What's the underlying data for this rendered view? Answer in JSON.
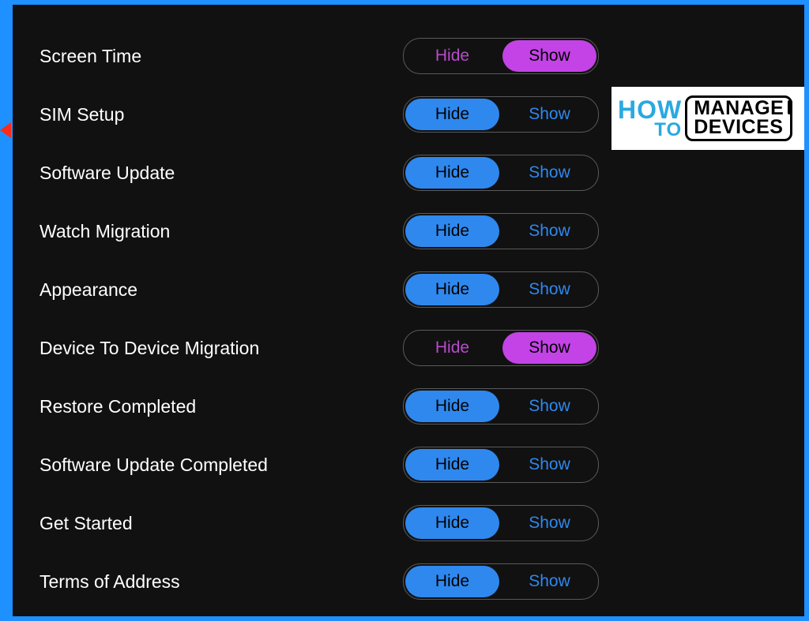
{
  "toggle_labels": {
    "hide": "Hide",
    "show": "Show"
  },
  "logo": {
    "how": "HOW",
    "to": "TO",
    "manage": "MANAGE",
    "devices": "DEVICES"
  },
  "rows": [
    {
      "label": "Screen Time",
      "state": "show"
    },
    {
      "label": "SIM Setup",
      "state": "hide"
    },
    {
      "label": "Software Update",
      "state": "hide"
    },
    {
      "label": "Watch Migration",
      "state": "hide"
    },
    {
      "label": "Appearance",
      "state": "hide"
    },
    {
      "label": "Device To Device Migration",
      "state": "show"
    },
    {
      "label": "Restore Completed",
      "state": "hide"
    },
    {
      "label": "Software Update Completed",
      "state": "hide"
    },
    {
      "label": "Get Started",
      "state": "hide"
    },
    {
      "label": "Terms of Address",
      "state": "hide"
    }
  ]
}
